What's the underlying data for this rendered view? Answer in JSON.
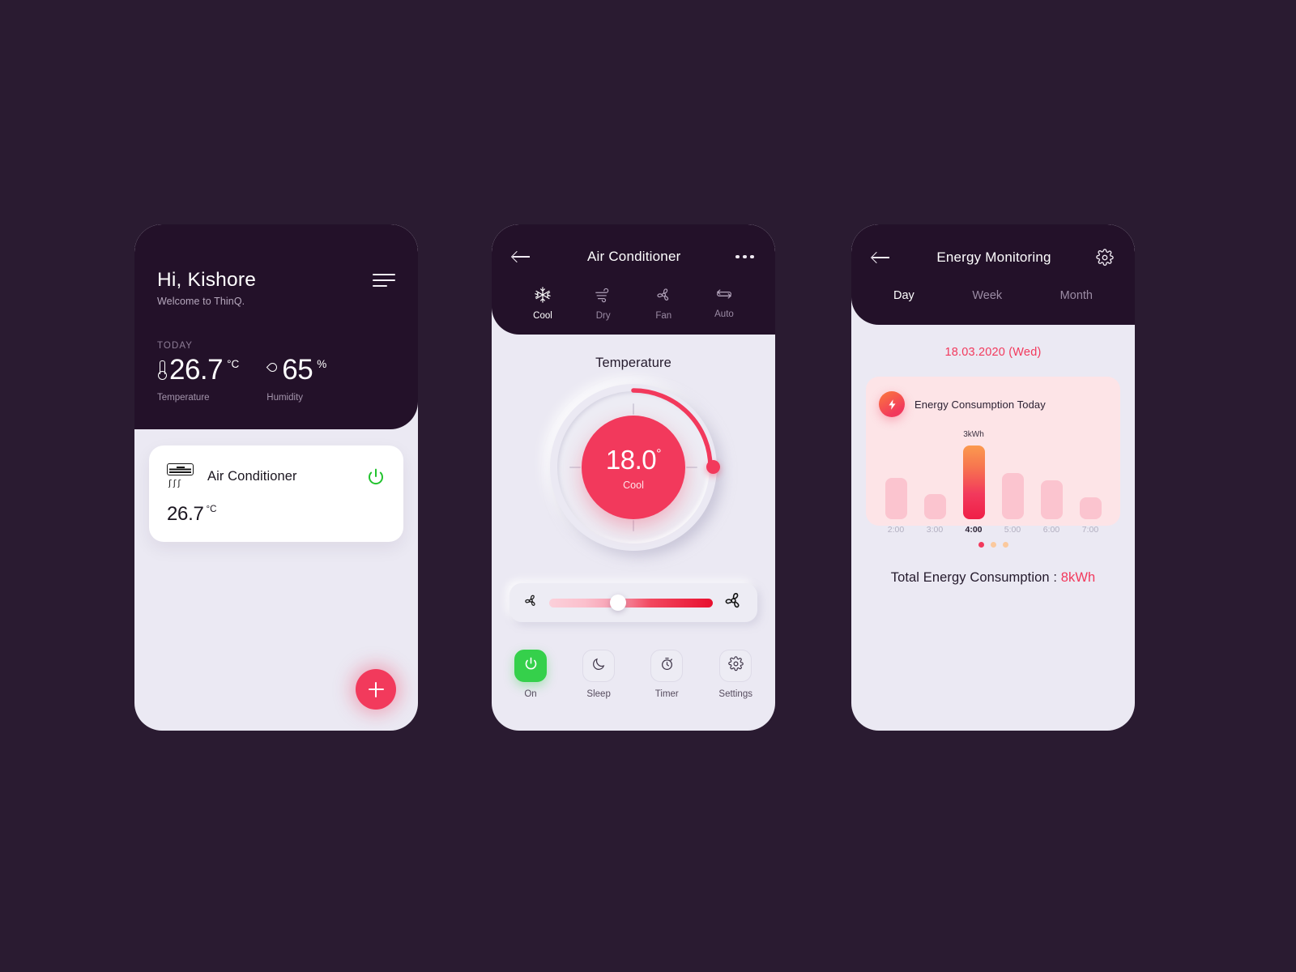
{
  "screen1": {
    "greeting": "Hi, Kishore",
    "subtitle": "Welcome to ThinQ.",
    "today_label": "TODAY",
    "temperature": {
      "value": "26.7",
      "unit": "°C",
      "caption": "Temperature"
    },
    "humidity": {
      "value": "65",
      "unit": "%",
      "caption": "Humidity"
    },
    "device": {
      "name": "Air Conditioner",
      "temp": "26.7",
      "temp_unit": "°C",
      "power_state_color": "#22c32e",
      "waves": "ʃʃʃ"
    },
    "fab_label": "+"
  },
  "screen2": {
    "title": "Air Conditioner",
    "modes": [
      {
        "label": "Cool",
        "icon": "snowflake-icon",
        "active": true
      },
      {
        "label": "Dry",
        "icon": "wind-icon",
        "active": false
      },
      {
        "label": "Fan",
        "icon": "fan-icon",
        "active": false
      },
      {
        "label": "Auto",
        "icon": "auto-loop-icon",
        "active": false
      }
    ],
    "section_title": "Temperature",
    "dial": {
      "value": "18.0",
      "degree": "°",
      "mode": "Cool",
      "arc_color": "#f2395c"
    },
    "fan_slider": {
      "min_icon": "fan-small-icon",
      "max_icon": "fan-large-icon",
      "position_percent": 42
    },
    "controls": [
      {
        "label": "On",
        "icon": "power-icon",
        "active": true
      },
      {
        "label": "Sleep",
        "icon": "moon-icon",
        "active": false
      },
      {
        "label": "Timer",
        "icon": "stopwatch-icon",
        "active": false
      },
      {
        "label": "Settings",
        "icon": "gear-icon",
        "active": false
      }
    ]
  },
  "screen3": {
    "title": "Energy Monitoring",
    "tabs": [
      {
        "label": "Day",
        "active": true
      },
      {
        "label": "Week",
        "active": false
      },
      {
        "label": "Month",
        "active": false
      }
    ],
    "date": "18.03.2020 (Wed)",
    "card_title": "Energy Consumption Today",
    "total_label": "Total Energy Consumption : ",
    "total_value": "8kWh",
    "pagination": [
      true,
      false,
      false
    ]
  },
  "chart_data": {
    "type": "bar",
    "title": "Energy Consumption Today",
    "categories": [
      "2:00",
      "3:00",
      "4:00",
      "5:00",
      "6:00",
      "7:00"
    ],
    "values": [
      1.55,
      0.95,
      3.0,
      1.75,
      1.45,
      0.8
    ],
    "value_labels": [
      "",
      "",
      "3kWh",
      "",
      "",
      ""
    ],
    "highlight_index": 2,
    "unit": "kWh",
    "xlabel": "",
    "ylabel": "",
    "ylim": [
      0,
      3.3
    ],
    "grid": false,
    "legend": "none",
    "bar_color": "#fbc4cf",
    "highlight_color": "#f2395c"
  }
}
